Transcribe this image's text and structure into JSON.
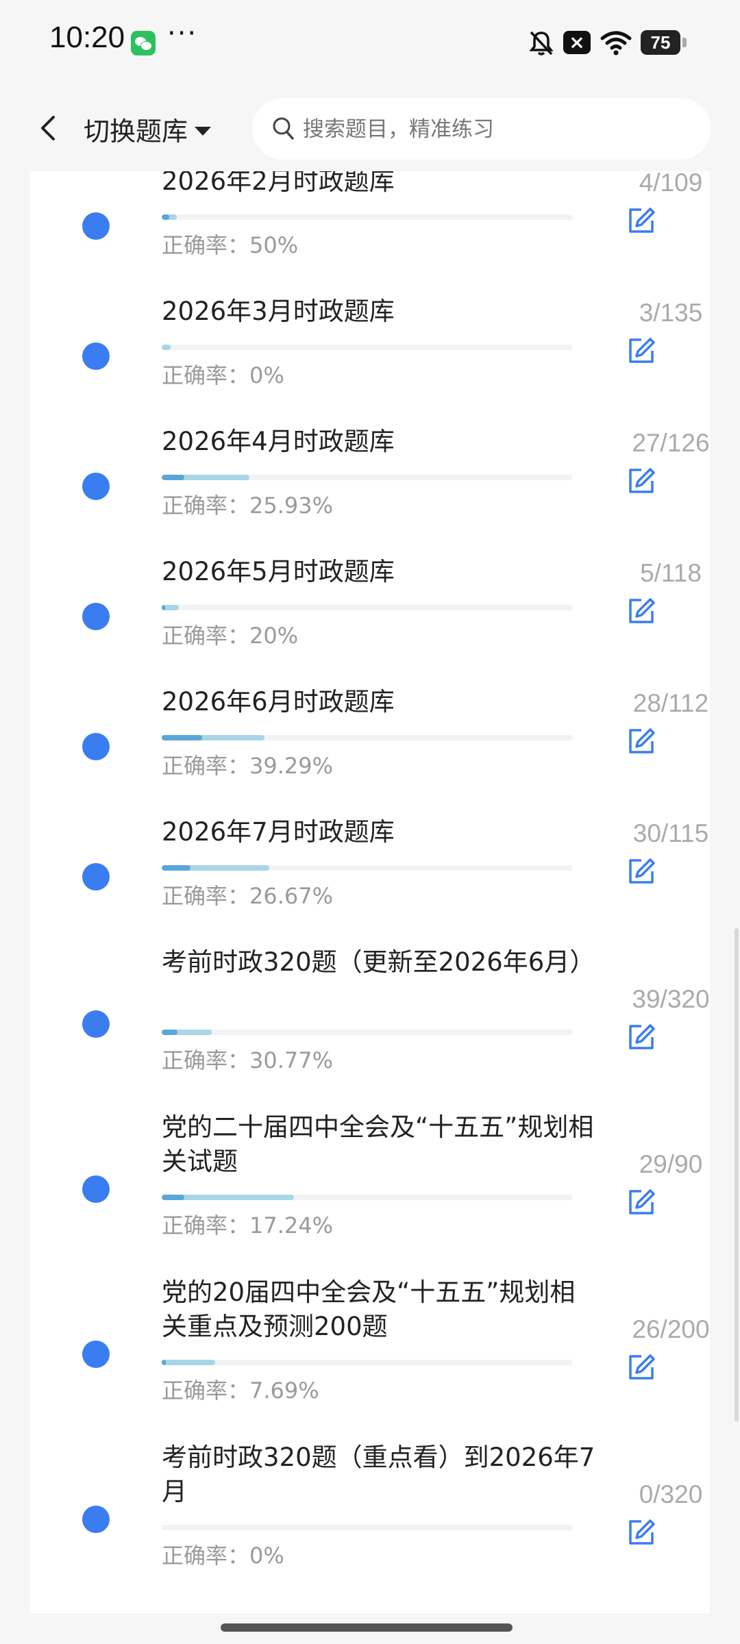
{
  "status_bar": {
    "time": "10:20",
    "more": "···",
    "battery": "75",
    "icons": [
      "wechat-icon",
      "bell-off-icon",
      "close-icon",
      "wifi-icon",
      "battery-icon"
    ]
  },
  "header": {
    "bank_switch_label": "切换题库",
    "search_placeholder": "搜索题目，精准练习"
  },
  "items": [
    {
      "title": "2026年2月时政题库",
      "accuracy_label": "正确率：50%",
      "count": "4/109",
      "progress": 0.037,
      "accuracy": 0.5
    },
    {
      "title": "2026年3月时政题库",
      "accuracy_label": "正确率：0%",
      "count": "3/135",
      "progress": 0.022,
      "accuracy": 0.0
    },
    {
      "title": "2026年4月时政题库",
      "accuracy_label": "正确率：25.93%",
      "count": "27/126",
      "progress": 0.214,
      "accuracy": 0.2593
    },
    {
      "title": "2026年5月时政题库",
      "accuracy_label": "正确率：20%",
      "count": "5/118",
      "progress": 0.042,
      "accuracy": 0.2
    },
    {
      "title": "2026年6月时政题库",
      "accuracy_label": "正确率：39.29%",
      "count": "28/112",
      "progress": 0.25,
      "accuracy": 0.3929
    },
    {
      "title": "2026年7月时政题库",
      "accuracy_label": "正确率：26.67%",
      "count": "30/115",
      "progress": 0.261,
      "accuracy": 0.2667
    },
    {
      "title": "考前时政320题（更新至2026年6月）",
      "accuracy_label": "正确率：30.77%",
      "count": "39/320",
      "progress": 0.122,
      "accuracy": 0.3077
    },
    {
      "title": "党的二十届四中全会及“十五五”规划相关试题",
      "accuracy_label": "正确率：17.24%",
      "count": "29/90",
      "progress": 0.322,
      "accuracy": 0.1724
    },
    {
      "title": "党的20届四中全会及“十五五”规划相关重点及预测200题",
      "accuracy_label": "正确率：7.69%",
      "count": "26/200",
      "progress": 0.13,
      "accuracy": 0.0769
    },
    {
      "title": "考前时政320题（重点看）到2026年7月",
      "accuracy_label": "正确率：0%",
      "count": "0/320",
      "progress": 0.0,
      "accuracy": 0.0
    }
  ],
  "colors": {
    "dot": "#3a7df0",
    "bar_track": "#f1f3f5",
    "bar_progress": "#a8d6e6",
    "bar_accuracy": "#5aa6d8",
    "edit_icon": "#3a7df0"
  }
}
